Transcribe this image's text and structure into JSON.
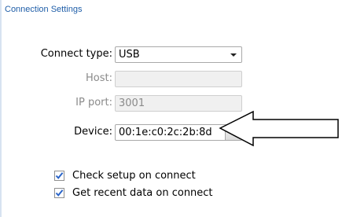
{
  "section_title": "Connection Settings",
  "connect_type": {
    "label": "Connect type:",
    "value": "USB"
  },
  "host": {
    "label": "Host:",
    "value": ""
  },
  "ip_port": {
    "label": "IP port:",
    "value": "3001"
  },
  "device": {
    "label": "Device:",
    "value": "00:1e:c0:2c:2b:8d"
  },
  "checks": [
    {
      "label": "Check setup on connect",
      "checked": true
    },
    {
      "label": "Get recent data on connect",
      "checked": true
    }
  ],
  "colors": {
    "accent": "#1f5ea8",
    "check": "#2a64c8"
  }
}
